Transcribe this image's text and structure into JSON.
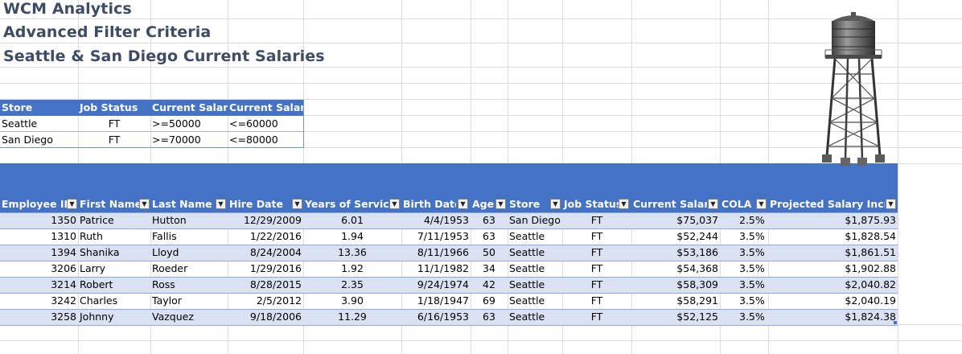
{
  "titles": {
    "line1": "WCM Analytics",
    "line2": "Advanced Filter Criteria",
    "line3": "Seattle & San Diego Current Salaries"
  },
  "criteria": {
    "headers": [
      "Store",
      "Job Status",
      "Current Salary",
      "Current Salary"
    ],
    "rows": [
      [
        "Seattle",
        "FT",
        ">=50000",
        "<=60000"
      ],
      [
        "San Diego",
        "FT",
        ">=70000",
        "<=80000"
      ]
    ]
  },
  "table": {
    "headers": [
      "Employee ID",
      "First Name",
      "Last Name",
      "Hire Date",
      "Years of Service",
      "Birth Date",
      "Age",
      "Store",
      "Job Status",
      "Current Salary",
      "COLA",
      "Projected Salary Increa"
    ],
    "rows": [
      [
        "1350",
        "Patrice",
        "Hutton",
        "12/29/2009",
        "6.01",
        "4/4/1953",
        "63",
        "San Diego",
        "FT",
        "$75,037",
        "2.5%",
        "$1,875.93"
      ],
      [
        "1310",
        "Ruth",
        "Fallis",
        "1/22/2016",
        "1.94",
        "7/11/1953",
        "63",
        "Seattle",
        "FT",
        "$52,244",
        "3.5%",
        "$1,828.54"
      ],
      [
        "1394",
        "Shanika",
        "Lloyd",
        "8/24/2004",
        "13.36",
        "8/11/1966",
        "50",
        "Seattle",
        "FT",
        "$53,186",
        "3.5%",
        "$1,861.51"
      ],
      [
        "3206",
        "Larry",
        "Roeder",
        "1/29/2016",
        "1.92",
        "11/1/1982",
        "34",
        "Seattle",
        "FT",
        "$54,368",
        "3.5%",
        "$1,902.88"
      ],
      [
        "3214",
        "Robert",
        "Ross",
        "8/28/2015",
        "2.35",
        "9/24/1974",
        "42",
        "Seattle",
        "FT",
        "$58,309",
        "3.5%",
        "$2,040.82"
      ],
      [
        "3242",
        "Charles",
        "Taylor",
        "2/5/2012",
        "3.90",
        "1/18/1947",
        "69",
        "Seattle",
        "FT",
        "$58,291",
        "3.5%",
        "$2,040.19"
      ],
      [
        "3258",
        "Johnny",
        "Vazquez",
        "9/18/2006",
        "11.29",
        "6/16/1953",
        "63",
        "Seattle",
        "FT",
        "$52,125",
        "3.5%",
        "$1,824.38"
      ]
    ]
  },
  "image": {
    "icon": "water-tower-image"
  },
  "colors": {
    "header_blue": "#4472c4",
    "band_light": "#d9e1f2",
    "title_text": "#3d4b66"
  }
}
